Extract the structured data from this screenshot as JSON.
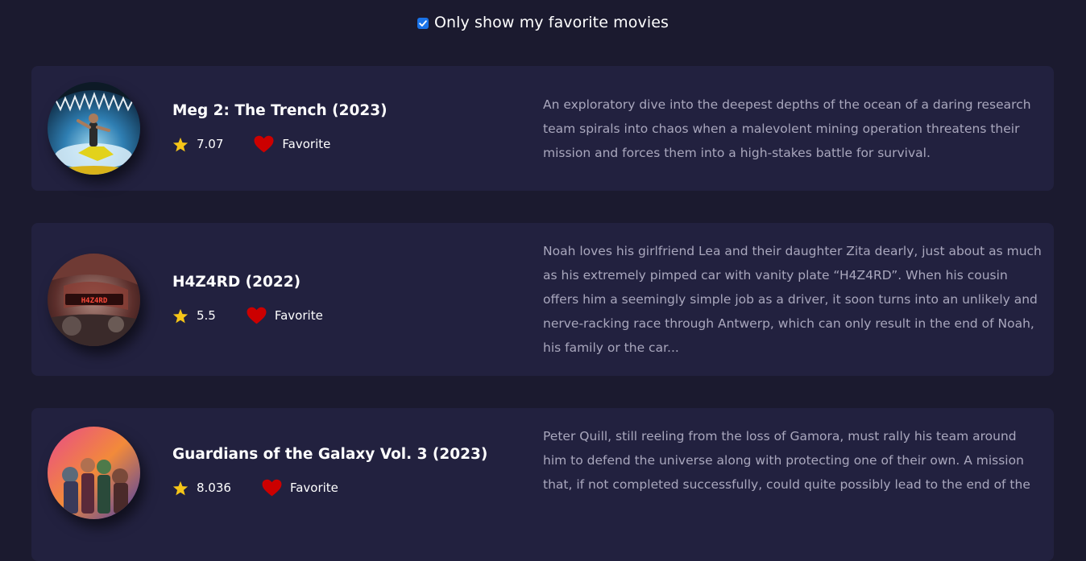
{
  "filter": {
    "checked": true,
    "label": "Only show my favorite movies"
  },
  "colors": {
    "background": "#1b1a2f",
    "card": "#22213f",
    "star": "#f5c518",
    "heart": "#cc0000",
    "checkbox": "#1a73e8",
    "overview_text": "#a9a7bd"
  },
  "movies": [
    {
      "title": "Meg 2: The Trench (2023)",
      "rating": "7.07",
      "favorite_label": "Favorite",
      "overview": "An exploratory dive into the deepest depths of the ocean of a daring research team spirals into chaos when a malevolent mining operation threatens their mission and forces them into a high-stakes battle for survival."
    },
    {
      "title": "H4Z4RD (2022)",
      "rating": "5.5",
      "favorite_label": "Favorite",
      "poster_text": "H4Z4RD",
      "overview": "Noah loves his girlfriend Lea and their daughter Zita dearly, just about as much as his extremely pimped car with vanity plate “H4Z4RD”. When his cousin offers him a seemingly simple job as a driver, it soon turns into an unlikely and nerve-racking race through Antwerp, which can only result in the end of Noah, his family or the car..."
    },
    {
      "title": "Guardians of the Galaxy Vol. 3 (2023)",
      "rating": "8.036",
      "favorite_label": "Favorite",
      "overview": "Peter Quill, still reeling from the loss of Gamora, must rally his team around him to defend the universe along with protecting one of their own. A mission that, if not completed successfully, could quite possibly lead to the end of the"
    }
  ]
}
